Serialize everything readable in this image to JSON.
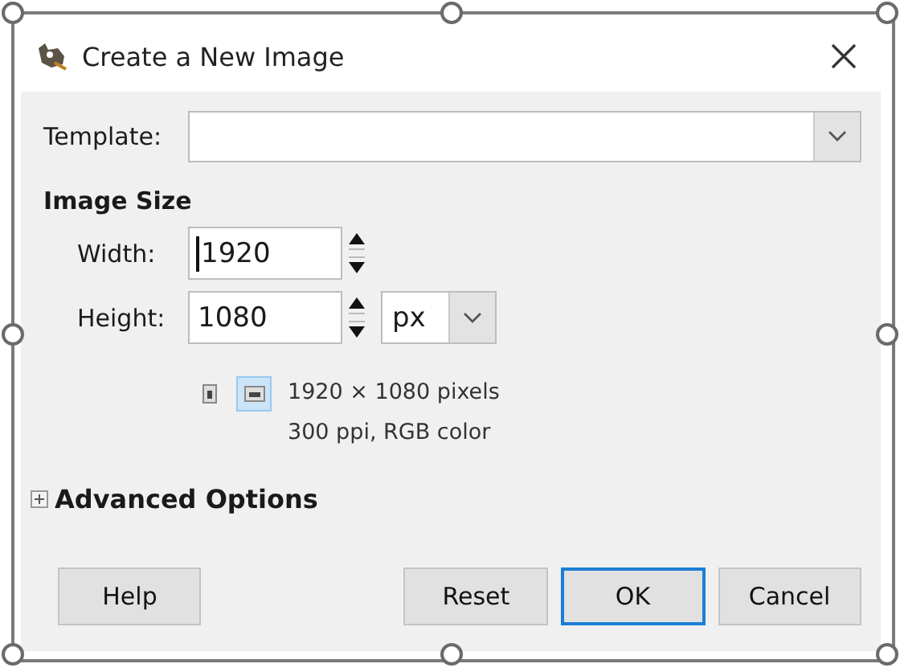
{
  "window": {
    "title": "Create a New Image"
  },
  "template": {
    "label": "Template:"
  },
  "image_size": {
    "heading": "Image Size",
    "width": {
      "label": "Width:",
      "value": "1920",
      "focused": true
    },
    "height": {
      "label": "Height:",
      "value": "1080",
      "focused": false
    },
    "unit": "px",
    "orientations": [
      {
        "kind": "portrait",
        "selected": false
      },
      {
        "kind": "landscape",
        "selected": true
      }
    ],
    "info_lines": [
      "1920 × 1080 pixels",
      "300 ppi, RGB color"
    ]
  },
  "advanced_options": {
    "label": "Advanced Options",
    "expanded": false
  },
  "buttons": [
    {
      "label": "Help",
      "default": false
    },
    {
      "label": "Reset",
      "default": false
    },
    {
      "label": "OK",
      "default": true
    },
    {
      "label": "Cancel",
      "default": false
    }
  ]
}
